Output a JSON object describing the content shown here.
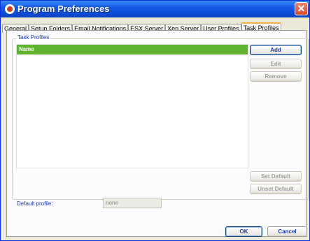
{
  "window": {
    "title": "Program Preferences"
  },
  "tabs": [
    {
      "label": "General"
    },
    {
      "label": "Setup Folders"
    },
    {
      "label": "Email Notifications"
    },
    {
      "label": "ESX Server"
    },
    {
      "label": "Xen Server"
    },
    {
      "label": "User Profiles"
    },
    {
      "label": "Task Profiles"
    }
  ],
  "active_tab": "Task Profiles",
  "group": {
    "label": "Task Profiles"
  },
  "list": {
    "header": "Name",
    "items": []
  },
  "buttons": {
    "add": "Add",
    "edit": "Edit",
    "remove": "Remove",
    "set_default": "Set Default",
    "unset_default": "Unset Default",
    "ok": "OK",
    "cancel": "Cancel"
  },
  "default_profile": {
    "label": "Default profile:",
    "value": "none"
  }
}
